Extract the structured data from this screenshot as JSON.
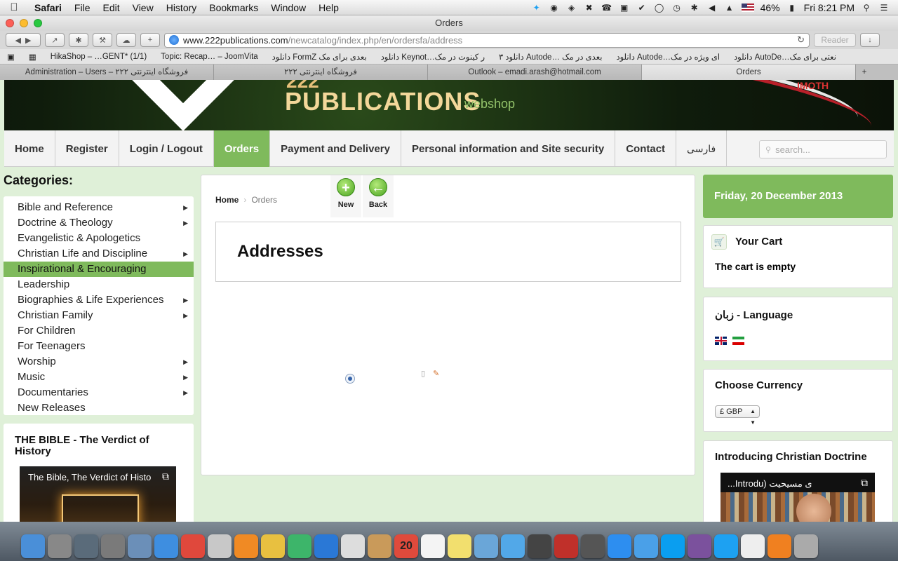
{
  "menubar": {
    "app": "Safari",
    "items": [
      "File",
      "Edit",
      "View",
      "History",
      "Bookmarks",
      "Window",
      "Help"
    ],
    "battery": "46%",
    "clock": "Fri 8:21 PM"
  },
  "window": {
    "title": "Orders"
  },
  "toolbar": {
    "url_host": "www.222publications.com",
    "url_path": "/newcatalog/index.php/en/ordersfa/address",
    "reader": "Reader"
  },
  "bookmarks": [
    "HikaShop – …GENT* (1/1)",
    "Topic: Recap… – JoomVita",
    "دانلود FormZ بعدی برای مک",
    "دانلود Keynot…ر کینوت در مک",
    "دانلود ۳ Autode… بعدی در مک",
    "دانلود Autode…ای ویژه در مک",
    "دانلود AutoDe…نعتی برای مک"
  ],
  "tabs": [
    "Administration – Users – فروشگاه اینترنتی ۲۲۲",
    "فروشگاه اینترنتی ۲۲۲",
    "Outlook – emadi.arash@hotmail.com",
    "Orders"
  ],
  "banner": {
    "number": "222",
    "publications": "PUBLICATIONS",
    "webshop": "webshop",
    "corner": "IMOTH"
  },
  "nav": {
    "items": [
      "Home",
      "Register",
      "Login / Logout",
      "Orders",
      "Payment and Delivery",
      "Personal information and Site security",
      "Contact",
      "فارسی"
    ],
    "search_placeholder": "search..."
  },
  "sidebar": {
    "categories_title": "Categories:",
    "categories": [
      {
        "label": "Bible and Reference",
        "arrow": true
      },
      {
        "label": "Doctrine & Theology",
        "arrow": true
      },
      {
        "label": "Evangelistic & Apologetics",
        "arrow": false
      },
      {
        "label": "Christian Life and Discipline",
        "arrow": true
      },
      {
        "label": "Inspirational & Encouraging",
        "arrow": false
      },
      {
        "label": "Leadership",
        "arrow": false
      },
      {
        "label": "Biographies & Life Experiences",
        "arrow": true
      },
      {
        "label": "Christian Family",
        "arrow": true
      },
      {
        "label": "For Children",
        "arrow": false
      },
      {
        "label": "For Teenagers",
        "arrow": false
      },
      {
        "label": "Worship",
        "arrow": true
      },
      {
        "label": "Music",
        "arrow": true
      },
      {
        "label": "Documentaries",
        "arrow": true
      },
      {
        "label": "New Releases",
        "arrow": false
      }
    ],
    "video_title": "THE BIBLE - The Verdict of History",
    "video_caption": "The Bible, The Verdict of Histo"
  },
  "main": {
    "breadcrumb_home": "Home",
    "breadcrumb_current": "Orders",
    "new_label": "New",
    "back_label": "Back",
    "heading": "Addresses"
  },
  "right": {
    "date": "Friday, 20 December 2013",
    "cart_title": "Your Cart",
    "cart_status": "The cart is empty",
    "language_title": "زبان - Language",
    "currency_title": "Choose Currency",
    "currency_value": "£ GBP",
    "doctrine_title": "Introducing Christian Doctrine",
    "doctrine_caption": "...Introdu) ی مسیحیت"
  },
  "dock": {
    "icons": [
      "finder-icon",
      "rocket-icon",
      "folder-icon",
      "gear-icon",
      "eagle-icon",
      "compass-icon",
      "chrome-icon",
      "stamp-icon",
      "book-icon",
      "notes-icon",
      "chart-icon",
      "keynote-icon",
      "text-icon",
      "contacts-icon",
      "calendar-icon",
      "reminders-icon",
      "stickies-icon",
      "preview-icon",
      "messages-icon",
      "facetime-icon",
      "photobooth-icon",
      "camera-icon",
      "appstore-icon",
      "itunes-icon",
      "skype-icon",
      "viber-icon",
      "twitter-icon",
      "textedit-icon",
      "vlc-icon",
      "trash-icon"
    ],
    "calendar_day": "20"
  }
}
